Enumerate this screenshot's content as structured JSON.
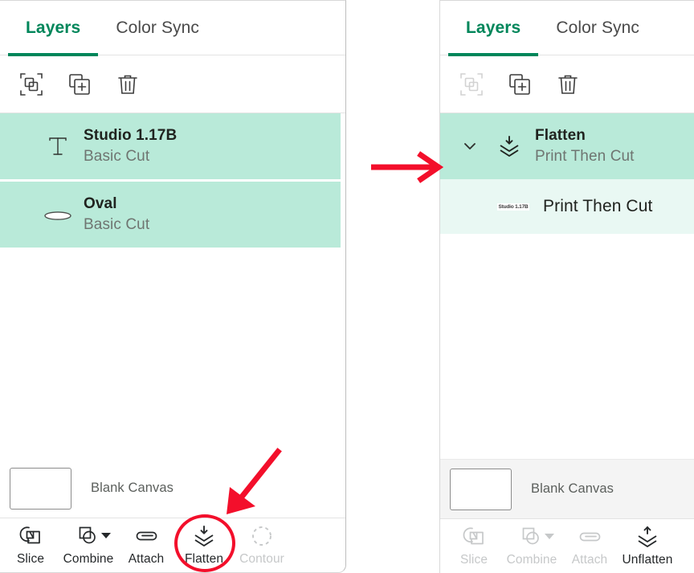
{
  "colors": {
    "accent_green": "#00865a",
    "selected_row": "#b9ead9",
    "child_row": "#e9f8f3",
    "annotation_red": "#f30f2b",
    "muted_text": "#6f7571",
    "disabled": "#c6c8c9",
    "canvas_row_grey": "#f4f4f4"
  },
  "left_panel": {
    "name": "before-flatten",
    "tabs": [
      {
        "label": "Layers",
        "active": true
      },
      {
        "label": "Color Sync",
        "active": false
      }
    ],
    "actions": [
      {
        "name": "group-icon",
        "label": "Group",
        "disabled": false
      },
      {
        "name": "duplicate-icon",
        "label": "Duplicate",
        "disabled": false
      },
      {
        "name": "delete-icon",
        "label": "Delete",
        "disabled": false
      }
    ],
    "layers": [
      {
        "icon": "text-layer-icon",
        "title": "Studio 1.17B",
        "subtitle": "Basic Cut",
        "selected": true
      },
      {
        "icon": "oval-layer-icon",
        "title": "Oval",
        "subtitle": "Basic Cut",
        "selected": true
      }
    ],
    "canvas": {
      "label": "Blank Canvas"
    },
    "tools": [
      {
        "name": "slice-tool",
        "label": "Slice",
        "disabled": false,
        "dropdown": false
      },
      {
        "name": "combine-tool",
        "label": "Combine",
        "disabled": false,
        "dropdown": true
      },
      {
        "name": "attach-tool",
        "label": "Attach",
        "disabled": false,
        "dropdown": false
      },
      {
        "name": "flatten-tool",
        "label": "Flatten",
        "disabled": false,
        "dropdown": false
      },
      {
        "name": "contour-tool",
        "label": "Contour",
        "disabled": true,
        "dropdown": false
      }
    ]
  },
  "right_panel": {
    "name": "after-flatten",
    "tabs": [
      {
        "label": "Layers",
        "active": true
      },
      {
        "label": "Color Sync",
        "active": false
      }
    ],
    "actions": [
      {
        "name": "group-icon",
        "label": "Group",
        "disabled": true
      },
      {
        "name": "duplicate-icon",
        "label": "Duplicate",
        "disabled": false
      },
      {
        "name": "delete-icon",
        "label": "Delete",
        "disabled": false
      }
    ],
    "layers": [
      {
        "icon": "flatten-layer-icon",
        "title": "Flatten",
        "subtitle": "Print Then Cut",
        "selected": true,
        "expanded": true
      }
    ],
    "child_layer": {
      "thumbnail_text": "Studio 1.17B",
      "label": "Print Then Cut"
    },
    "canvas": {
      "label": "Blank Canvas"
    },
    "tools": [
      {
        "name": "slice-tool",
        "label": "Slice",
        "disabled": true,
        "dropdown": false
      },
      {
        "name": "combine-tool",
        "label": "Combine",
        "disabled": true,
        "dropdown": true
      },
      {
        "name": "attach-tool",
        "label": "Attach",
        "disabled": true,
        "dropdown": false
      },
      {
        "name": "unflatten-tool",
        "label": "Unflatten",
        "disabled": false,
        "dropdown": false
      }
    ]
  },
  "annotations": {
    "transition_arrow": "right-arrow",
    "highlight_circle": "flatten-button-circle",
    "pointer_arrow": "arrow-to-flatten"
  }
}
